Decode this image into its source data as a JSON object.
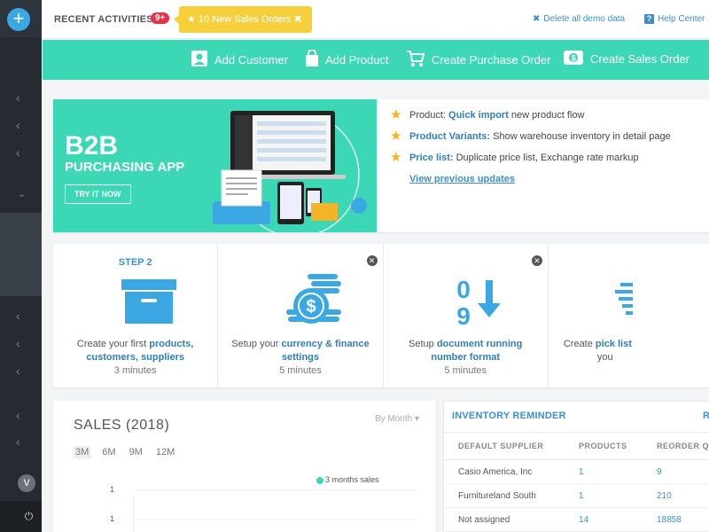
{
  "topbar": {
    "recent_label": "RECENT ACTIVITIES",
    "recent_count": "9+",
    "promo_text": "★ 10 New Sales Orders ✖",
    "delete_demo": "Delete all demo data",
    "help_center": "Help Center"
  },
  "actions": [
    {
      "label": "Add Customer",
      "icon": "customer-icon"
    },
    {
      "label": "Add Product",
      "icon": "product-bag-icon"
    },
    {
      "label": "Create Purchase Order",
      "icon": "cart-icon"
    },
    {
      "label": "Create Sales Order",
      "icon": "money-icon"
    }
  ],
  "banner": {
    "headline": "B2B",
    "subheadline": "PURCHASING APP",
    "cta": "TRY IT NOW",
    "notes": [
      {
        "prefix": "Product: ",
        "highlight": "Quick import",
        "rest": " new product flow"
      },
      {
        "prefix": "",
        "highlight": "Product Variants:",
        "rest": " Show warehouse inventory in detail page"
      },
      {
        "prefix": "",
        "highlight": "Price list:",
        "rest": " Duplicate price list, Exchange rate markup"
      }
    ],
    "previous_link": "View previous updates"
  },
  "steps": [
    {
      "title": "STEP 2",
      "desc_pre": "Create your first ",
      "desc_hl": "products, customers, suppliers",
      "desc_post": "",
      "time": "3 minutes",
      "icon": "archive-box-icon"
    },
    {
      "title": "",
      "desc_pre": "Setup your ",
      "desc_hl": "currency & finance settings",
      "desc_post": "",
      "time": "5 minutes",
      "icon": "coins-icon"
    },
    {
      "title": "",
      "desc_pre": "Setup ",
      "desc_hl": "document running number format",
      "desc_post": "",
      "time": "5 minutes",
      "icon": "sort-numeric-icon"
    },
    {
      "title": "",
      "desc_pre": "Create ",
      "desc_hl": "pick list",
      "desc_post": " you",
      "time": "",
      "icon": "list-icon"
    }
  ],
  "sales": {
    "title": "SALES (2018)",
    "by": "By Month ▾",
    "ranges": [
      "3M",
      "6M",
      "9M",
      "12M"
    ],
    "legend": "3 months sales",
    "ticks": [
      "1",
      "1"
    ]
  },
  "inventory": {
    "title": "INVENTORY REMINDER",
    "right_label": "R",
    "columns": [
      "DEFAULT SUPPLIER",
      "PRODUCTS",
      "REORDER Q"
    ],
    "rows": [
      {
        "supplier": "Casio America, Inc",
        "products": "1",
        "reorder": "9"
      },
      {
        "supplier": "Furnitureland South",
        "products": "1",
        "reorder": "210"
      },
      {
        "supplier": "Not assigned",
        "products": "14",
        "reorder": "18858"
      }
    ]
  },
  "colors": {
    "accent": "#3cd7b5",
    "link": "#3b8fd1",
    "sidebar": "#262b31",
    "badge": "#e8344b",
    "promo": "#f7cf3b"
  }
}
